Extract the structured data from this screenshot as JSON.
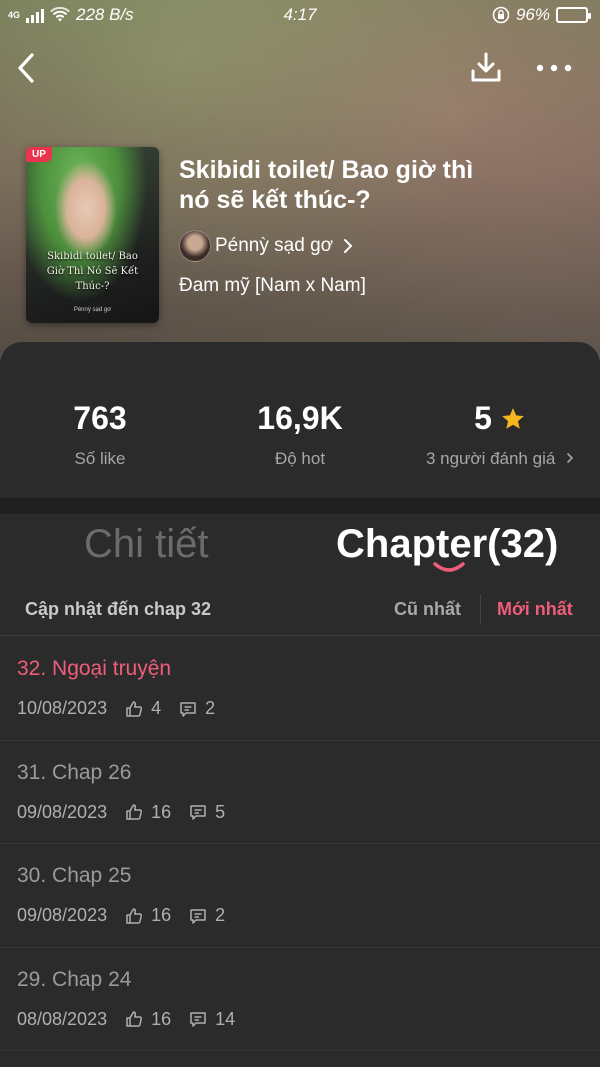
{
  "status": {
    "network": "4G",
    "speed": "228 B/s",
    "time": "4:17",
    "battery": "96%",
    "battery_level": 0.96
  },
  "book": {
    "badge": "UP",
    "cover_title": "Skibidi toilet/ Bao Giờ Thì Nó Sẽ Kết Thúc-?",
    "cover_author": "Pénnỳ sạd gơ",
    "title": "Skibidi toilet/ Bao giờ thì nó sẽ kết thúc-?",
    "author": "Pénnỳ sạd gơ",
    "genre": "Đam mỹ [Nam x Nam]"
  },
  "stats": [
    {
      "value": "763",
      "label": "Số like"
    },
    {
      "value": "16,9K",
      "label": "Độ hot"
    },
    {
      "value": "5",
      "label": "3 người đánh giá"
    }
  ],
  "tabs": {
    "detail": "Chi tiết",
    "chapter": "Chapter(32)"
  },
  "filter": {
    "update_text": "Cập nhật đến chap 32",
    "oldest": "Cũ nhất",
    "newest": "Mới nhất"
  },
  "chapters": [
    {
      "title": "32. Ngoại truyện",
      "date": "10/08/2023",
      "likes": "4",
      "comments": "2"
    },
    {
      "title": "31. Chap 26",
      "date": "09/08/2023",
      "likes": "16",
      "comments": "5"
    },
    {
      "title": "30. Chap 25",
      "date": "09/08/2023",
      "likes": "16",
      "comments": "2"
    },
    {
      "title": "29. Chap 24",
      "date": "08/08/2023",
      "likes": "16",
      "comments": "14"
    }
  ],
  "colors": {
    "accent": "#ef5d7a",
    "star": "#f5b51f",
    "panel": "#2b2b2b"
  }
}
